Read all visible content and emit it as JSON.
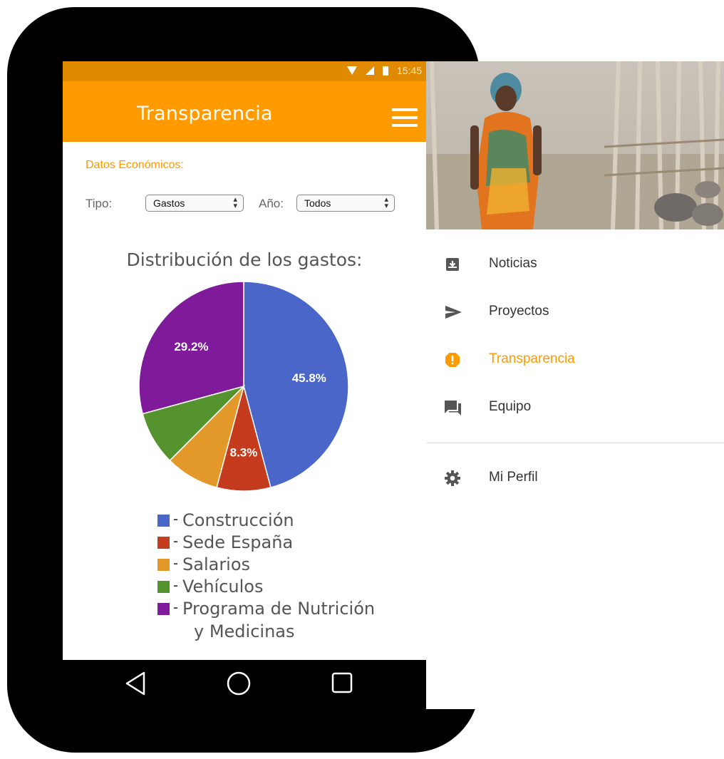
{
  "status_bar": {
    "time": "15:45"
  },
  "app_bar": {
    "title": "Transparencia",
    "menu_icon": "hamburger-menu-icon"
  },
  "section": {
    "title": "Datos Económicos:"
  },
  "filters": {
    "tipo_label": "Tipo:",
    "tipo_value": "Gastos",
    "anio_label": "Año:",
    "anio_value": "Todos"
  },
  "chart_title": "Distribución de los gastos:",
  "chart_data": {
    "type": "pie",
    "title": "Distribución de los gastos:",
    "categories": [
      "Construcción",
      "Sede España",
      "Salarios",
      "Vehículos",
      "Programa de Nutrición y Medicinas"
    ],
    "values": [
      45.8,
      8.3,
      8.3,
      8.3,
      29.2
    ],
    "labels": [
      "45.8%",
      "8.3%",
      "",
      "",
      "29.2%"
    ],
    "colors": [
      "#4a66c9",
      "#c43c1d",
      "#e3982a",
      "#55932f",
      "#7f1a9a"
    ],
    "legend_position": "bottom"
  },
  "legend": {
    "items": [
      {
        "name": "Construcción",
        "color": "#4a66c9"
      },
      {
        "name": "Sede España",
        "color": "#c43c1d"
      },
      {
        "name": "Salarios",
        "color": "#e3982a"
      },
      {
        "name": "Vehículos",
        "color": "#55932f"
      },
      {
        "name": "Programa de Nutrición",
        "color": "#7f1a9a"
      }
    ],
    "last_item_line2": "y Medicinas",
    "dash": "-"
  },
  "drawer": {
    "items": [
      {
        "label": "Noticias",
        "icon": "inbox-download-icon",
        "active": false
      },
      {
        "label": "Proyectos",
        "icon": "send-icon",
        "active": false
      },
      {
        "label": "Transparencia",
        "icon": "alert-octagon-icon",
        "active": true
      },
      {
        "label": "Equipo",
        "icon": "forum-icon",
        "active": false
      },
      {
        "label": "Mi Perfil",
        "icon": "gear-icon",
        "active": false
      }
    ]
  },
  "nav_bar": {
    "icons": [
      "back-icon",
      "home-icon",
      "recents-icon"
    ]
  },
  "colors": {
    "status_bar": "#e08a00",
    "app_bar": "#ff9a00",
    "accent": "#ff9a00",
    "phone": "#000000"
  }
}
